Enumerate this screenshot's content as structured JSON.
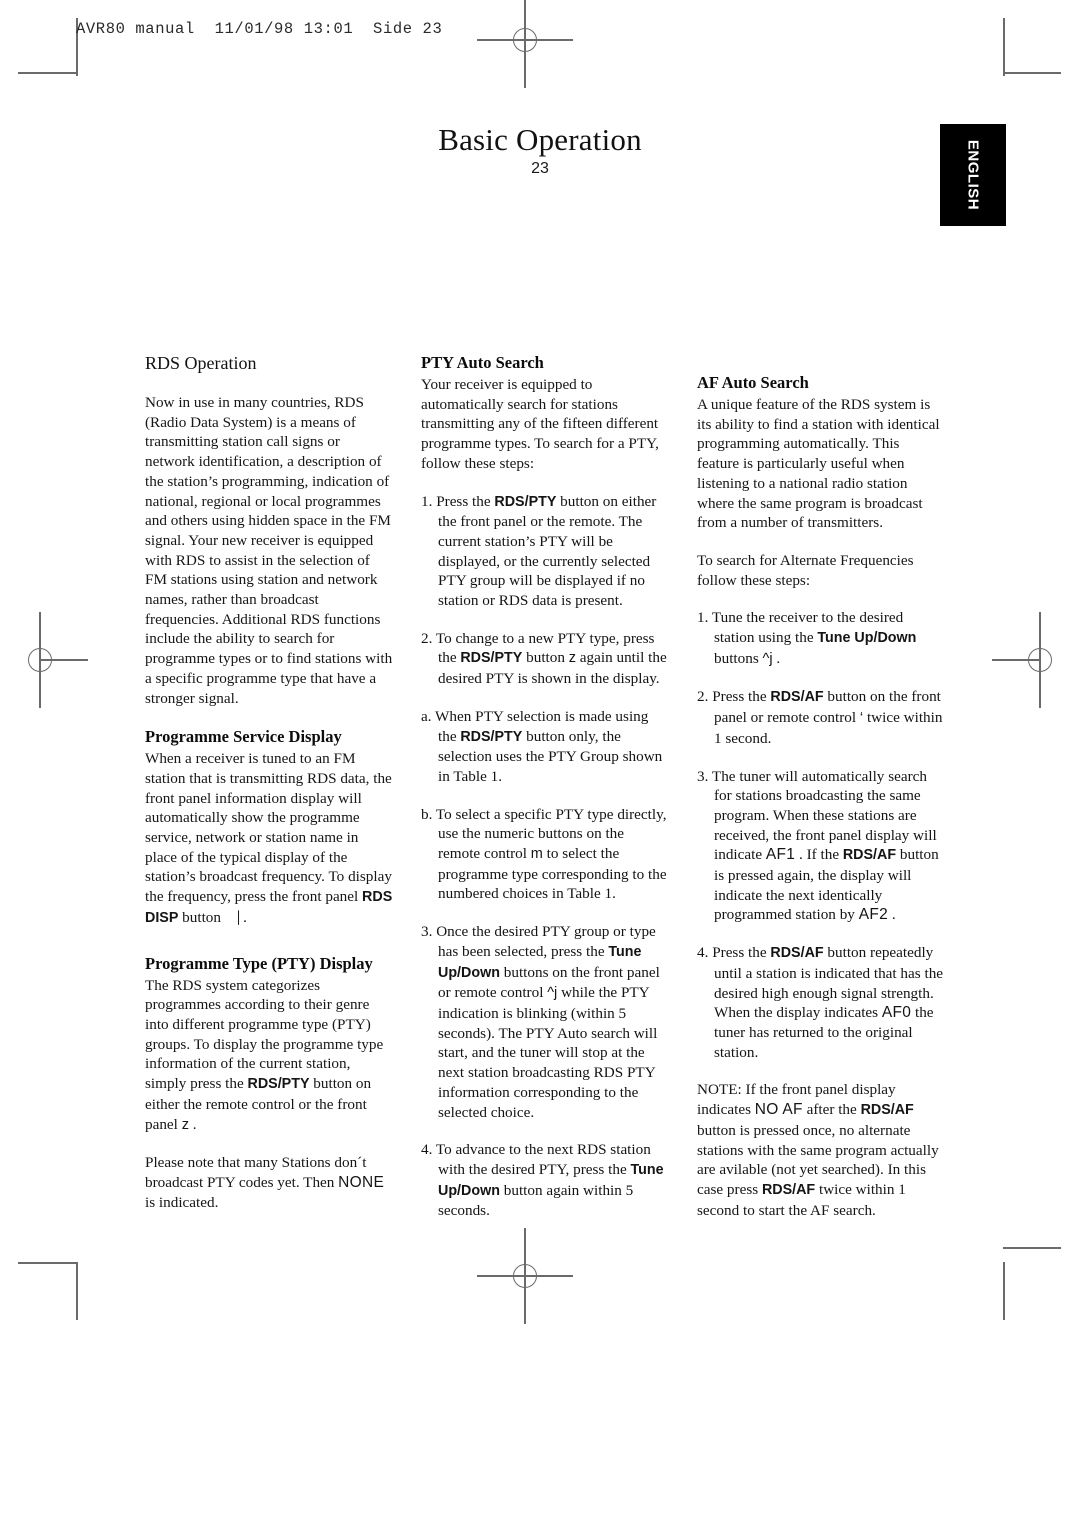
{
  "slug": "AVR80 manual  11/01/98 13:01  Side 23",
  "title": "Basic Operation",
  "page_number": "23",
  "language_tab": "ENGLISH",
  "column1": {
    "heading_rds": "RDS Operation",
    "rds_body": "Now in use in many countries, RDS (Radio Data System) is a means of transmitting station call signs or network identification, a description of the station’s programming, indication of national, regional or local programmes and others using hidden space in the FM signal. Your new receiver is equipped with RDS to assist in the selection of FM stations using station and network names, rather than broadcast frequencies. Additional RDS functions include the ability to search for programme types or to find stations with a specific programme type that have a stronger signal.",
    "heading_psd": "Programme Service Display",
    "psd_body_a": "When a receiver is tuned to an FM station that is transmitting RDS data, the front panel information display will automatically show the programme service, network or station name in place of the typical display of the station’s broadcast frequency. To display the frequency, press the front panel ",
    "psd_btn": "RDS DISP",
    "psd_body_b": " button ",
    "psd_glyph": "⎹",
    "psd_body_c": " .",
    "heading_pty": "Programme Type (PTY) Display",
    "pty_body_a": "The RDS system categorizes programmes according to their genre into different programme type (PTY) groups. To display the programme type information of the current station, simply press the ",
    "pty_btn": "RDS/PTY",
    "pty_body_b": " button on either the remote control or the front panel ",
    "pty_glyph": "z",
    "pty_body_c": "  .",
    "pty_note_a": "Please note that many Stations don´t broadcast PTY codes yet. Then ",
    "pty_note_disp": "NONE",
    "pty_note_b": " is indicated."
  },
  "column2": {
    "heading": "PTY Auto Search",
    "intro": "Your receiver is equipped to automatically search for stations transmitting any of the fifteen different programme types. To search for a PTY, follow these steps:",
    "step1_a": "1. Press the ",
    "step1_btn": "RDS/PTY",
    "step1_b": " button on either the front panel or the remote. The current station’s PTY will be displayed, or the currently selected PTY group will be displayed if no station or RDS data is present.",
    "step2_a": "2. To change to a new PTY type, press the ",
    "step2_btn": "RDS/PTY",
    "step2_b": " button ",
    "step2_glyph": "z",
    "step2_c": "  again until the desired PTY is shown in the display.",
    "step2a_a": "a. When PTY selection is made using the ",
    "step2a_btn": "RDS/PTY",
    "step2a_b": " button only, the selection uses the PTY Group shown in Table 1.",
    "step2b_a": "b. To select a specific PTY type directly, use the numeric buttons on the remote control ",
    "step2b_glyph": "m",
    "step2b_b": "  to select the programme type corresponding to the numbered choices in Table 1.",
    "step3_a": "3. Once the desired PTY group or type has been selected, press the ",
    "step3_btn": "Tune Up/Down",
    "step3_b": " buttons on the front panel or remote control ",
    "step3_glyph": "^j",
    "step3_c": "  while the PTY indication is blinking (within 5 seconds). The PTY Auto search will start, and the tuner will stop at the next station broadcasting RDS PTY information corresponding to the selected choice.",
    "step4_a": "4. To advance to the next RDS station with the desired PTY, press the ",
    "step4_btn": "Tune Up/Down",
    "step4_b": " button again within 5 seconds."
  },
  "column3": {
    "heading": "AF Auto Search",
    "intro": "A unique feature of the RDS system is its ability to find a station with identical programming automatically. This feature is particularly useful when listening to a national radio station where the same program is broadcast from a number of transmitters.",
    "lead": "To search for Alternate Frequencies follow these steps:",
    "step1_a": "1. Tune the receiver to the desired station using the ",
    "step1_btn": "Tune Up/Down",
    "step1_b": " buttons ",
    "step1_glyph": "^j",
    "step1_c": "   .",
    "step2_a": "2. Press the ",
    "step2_btn": "RDS/AF",
    "step2_b": " button on the front panel or remote control ",
    "step2_glyph": "‘",
    "step2_c": "      twice within 1 second.",
    "step3_a": "3. The tuner will automatically search for stations broadcasting the same program. When these stations are received, the front panel display will indicate ",
    "step3_disp1": "AF1",
    "step3_b": "  . If the ",
    "step3_btn": "RDS/AF",
    "step3_c": " button is pressed again, the display will indicate the next identically programmed station by ",
    "step3_disp2": "AF2",
    "step3_d": "  .",
    "step4_a": "4. Press the ",
    "step4_btn": "RDS/AF",
    "step4_b": " button repeatedly until a station is indicated that has the desired high enough signal strength. When the display indicates ",
    "step4_disp": "AF0",
    "step4_c": "   the tuner has returned to the original station.",
    "note_a": "NOTE: If the front panel display indicates ",
    "note_disp": "NO AF",
    "note_b": " after the ",
    "note_btn1": "RDS/AF",
    "note_c": " button is pressed once, no alternate stations with the same program actually are avilable (not yet searched). In this case press ",
    "note_btn2": "RDS/AF",
    "note_d": " twice within 1 second to start the AF search."
  }
}
